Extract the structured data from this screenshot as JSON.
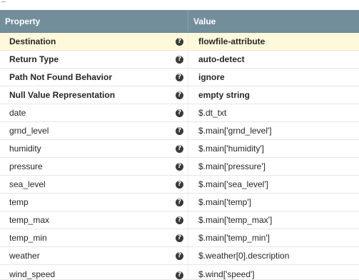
{
  "table": {
    "header": {
      "property_label": "Property",
      "value_label": "Value"
    },
    "help_icon_glyph": "?",
    "rows": [
      {
        "property": "Destination",
        "value": "flowfile-attribute"
      },
      {
        "property": "Return Type",
        "value": "auto-detect"
      },
      {
        "property": "Path Not Found Behavior",
        "value": "ignore"
      },
      {
        "property": "Null Value Representation",
        "value": "empty string"
      },
      {
        "property": "date",
        "value": "$.dt_txt"
      },
      {
        "property": "grnd_level",
        "value": "$.main['grnd_level']"
      },
      {
        "property": "humidity",
        "value": "$.main['humidity']"
      },
      {
        "property": "pressure",
        "value": "$.main['pressure']"
      },
      {
        "property": "sea_level",
        "value": "$.main['sea_level']"
      },
      {
        "property": "temp",
        "value": "$.main['temp']"
      },
      {
        "property": "temp_max",
        "value": "$.main['temp_max']"
      },
      {
        "property": "temp_min",
        "value": "$.main['temp_min']"
      },
      {
        "property": "weather",
        "value": "$.weather[0].description"
      },
      {
        "property": "wind_speed",
        "value": "$.wind['speed']"
      }
    ]
  },
  "colors": {
    "header_bg": "#728e9b",
    "selected_row_bg": "#fff9dc",
    "help_icon_bg": "#3a3a3a"
  }
}
